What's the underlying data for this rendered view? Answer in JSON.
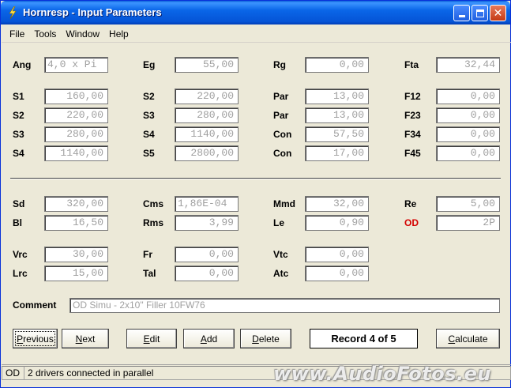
{
  "window": {
    "title": "Hornresp - Input Parameters"
  },
  "menu": [
    "File",
    "Tools",
    "Window",
    "Help"
  ],
  "rows": {
    "row1": [
      {
        "label": "Ang",
        "value": "4,0 x Pi"
      },
      {
        "label": "Eg",
        "value": "55,00"
      },
      {
        "label": "Rg",
        "value": "0,00"
      },
      {
        "label": "Fta",
        "value": "32,44"
      }
    ],
    "row2": [
      {
        "label": "S1",
        "value": "160,00"
      },
      {
        "label": "S2",
        "value": "220,00"
      },
      {
        "label": "Par",
        "value": "13,00"
      },
      {
        "label": "F12",
        "value": "0,00"
      }
    ],
    "row3": [
      {
        "label": "S2",
        "value": "220,00"
      },
      {
        "label": "S3",
        "value": "280,00"
      },
      {
        "label": "Par",
        "value": "13,00"
      },
      {
        "label": "F23",
        "value": "0,00"
      }
    ],
    "row4": [
      {
        "label": "S3",
        "value": "280,00"
      },
      {
        "label": "S4",
        "value": "1140,00"
      },
      {
        "label": "Con",
        "value": "57,50"
      },
      {
        "label": "F34",
        "value": "0,00"
      }
    ],
    "row5": [
      {
        "label": "S4",
        "value": "1140,00"
      },
      {
        "label": "S5",
        "value": "2800,00"
      },
      {
        "label": "Con",
        "value": "17,00"
      },
      {
        "label": "F45",
        "value": "0,00"
      }
    ],
    "row6": [
      {
        "label": "Sd",
        "value": "320,00"
      },
      {
        "label": "Cms",
        "value": "1,86E-04"
      },
      {
        "label": "Mmd",
        "value": "32,00"
      },
      {
        "label": "Re",
        "value": "5,00"
      }
    ],
    "row7": [
      {
        "label": "Bl",
        "value": "16,50"
      },
      {
        "label": "Rms",
        "value": "3,99"
      },
      {
        "label": "Le",
        "value": "0,90"
      },
      {
        "label": "OD",
        "value": "2P"
      }
    ],
    "row8": [
      {
        "label": "Vrc",
        "value": "30,00"
      },
      {
        "label": "Fr",
        "value": "0,00"
      },
      {
        "label": "Vtc",
        "value": "0,00"
      }
    ],
    "row9": [
      {
        "label": "Lrc",
        "value": "15,00"
      },
      {
        "label": "Tal",
        "value": "0,00"
      },
      {
        "label": "Atc",
        "value": "0,00"
      }
    ]
  },
  "comment": {
    "label": "Comment",
    "value": "OD Simu - 2x10\" Filler 10FW76"
  },
  "buttons": {
    "previous": {
      "first": "P",
      "rest": "revious"
    },
    "next": {
      "first": "N",
      "rest": "ext"
    },
    "edit": {
      "first": "E",
      "rest": "dit"
    },
    "add": {
      "first": "A",
      "rest": "dd"
    },
    "delete": {
      "first": "D",
      "rest": "elete"
    },
    "calculate": {
      "first": "C",
      "rest": "alculate"
    }
  },
  "record": "Record 4 of 5",
  "status": {
    "code": "OD",
    "text": "2 drivers connected in parallel"
  },
  "watermark": "www.AudioFotos.eu",
  "colors": {
    "title_bar": "#0A5FD8",
    "highlight_label": "#D40000",
    "disabled_value": "#A0A0A0"
  }
}
